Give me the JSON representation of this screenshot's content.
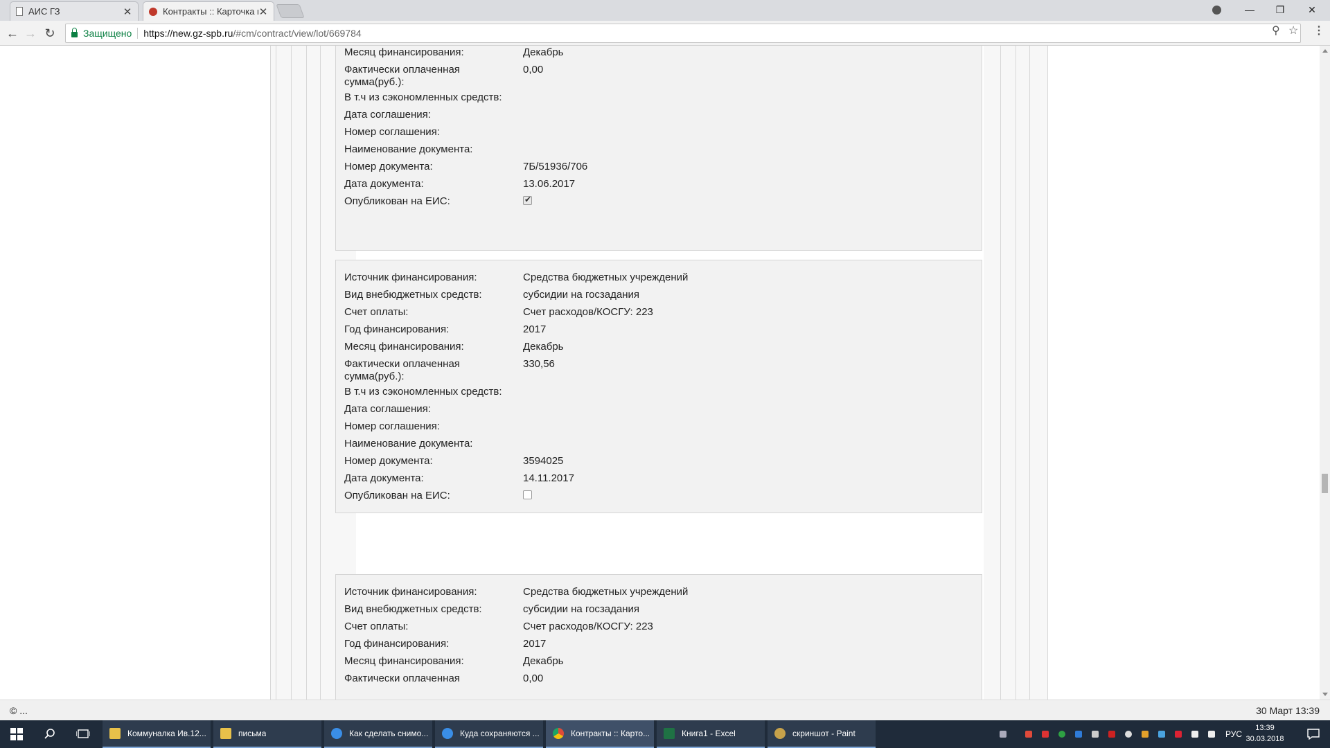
{
  "browser": {
    "tabs": [
      {
        "title": "АИС ГЗ"
      },
      {
        "title": "Контракты :: Карточка к"
      }
    ],
    "security_label": "Защищено",
    "url_host": "https://new.gz-spb.ru",
    "url_path": "/#cm/contract/view/lot/669784",
    "window_controls": {
      "minimize": "—",
      "restore": "❐",
      "close": "✕"
    }
  },
  "blocks": [
    {
      "rows": [
        {
          "label": "Месяц финансирования:",
          "value": "Декабрь"
        },
        {
          "label": "Фактически оплаченная сумма(руб.):",
          "value": "0,00"
        },
        {
          "label": "В т.ч из сэкономленных средств:",
          "value": ""
        },
        {
          "label": "Дата соглашения:",
          "value": ""
        },
        {
          "label": "Номер соглашения:",
          "value": ""
        },
        {
          "label": "Наименование документа:",
          "value": ""
        },
        {
          "label": "Номер документа:",
          "value": "7Б/51936/706"
        },
        {
          "label": "Дата документа:",
          "value": "13.06.2017"
        }
      ],
      "published_label": "Опубликован на ЕИС:",
      "published": true
    },
    {
      "rows": [
        {
          "label": "Источник финансирования:",
          "value": "Средства бюджетных учреждений"
        },
        {
          "label": "Вид внебюджетных средств:",
          "value": "субсидии на госзадания"
        },
        {
          "label": "Счет оплаты:",
          "value": "Счет расходов/КОСГУ: 223"
        },
        {
          "label": "Год финансирования:",
          "value": "2017"
        },
        {
          "label": "Месяц финансирования:",
          "value": "Декабрь"
        },
        {
          "label": "Фактически оплаченная сумма(руб.):",
          "value": "330,56"
        },
        {
          "label": "В т.ч из сэкономленных средств:",
          "value": ""
        },
        {
          "label": "Дата соглашения:",
          "value": ""
        },
        {
          "label": "Номер соглашения:",
          "value": ""
        },
        {
          "label": "Наименование документа:",
          "value": ""
        },
        {
          "label": "Номер документа:",
          "value": "3594025"
        },
        {
          "label": "Дата документа:",
          "value": "14.11.2017"
        }
      ],
      "published_label": "Опубликован на ЕИС:",
      "published": false
    },
    {
      "rows": [
        {
          "label": "Источник финансирования:",
          "value": "Средства бюджетных учреждений"
        },
        {
          "label": "Вид внебюджетных средств:",
          "value": "субсидии на госзадания"
        },
        {
          "label": "Счет оплаты:",
          "value": "Счет расходов/КОСГУ: 223"
        },
        {
          "label": "Год финансирования:",
          "value": "2017"
        },
        {
          "label": "Месяц финансирования:",
          "value": "Декабрь"
        },
        {
          "label": "Фактически оплаченная",
          "value": "0,00"
        }
      ]
    }
  ],
  "footer": {
    "left": "© ...",
    "right": "30 Март 13:39"
  },
  "taskbar": {
    "apps": [
      {
        "label": "Коммуналка Ив.12...",
        "color": "#e8c14a"
      },
      {
        "label": "письма",
        "color": "#e8c14a"
      },
      {
        "label": "Как сделать снимо...",
        "color": "#3a8ee6"
      },
      {
        "label": "Куда сохраняются ...",
        "color": "#3a8ee6"
      },
      {
        "label": "Контракты :: Карто...",
        "color": "#dd4b39"
      },
      {
        "label": "Книга1 - Excel",
        "color": "#1f7244"
      },
      {
        "label": "скриншот - Paint",
        "color": "#c7a24a"
      }
    ],
    "lang": "РУС",
    "time": "13:39",
    "date": "30.03.2018"
  }
}
